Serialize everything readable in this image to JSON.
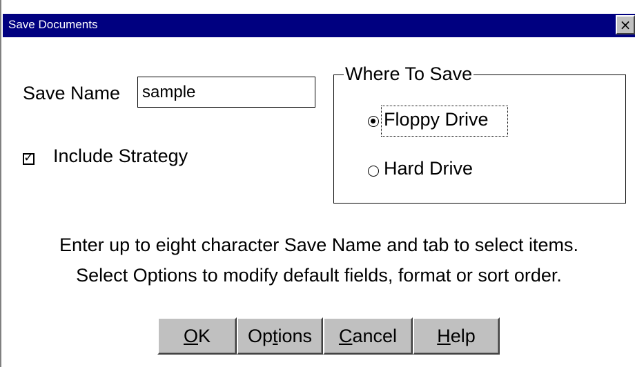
{
  "window": {
    "title": "Save Documents",
    "close_glyph": "×"
  },
  "form": {
    "save_name_label": "Save Name",
    "save_name_value": "sample",
    "include_strategy_label": "Include Strategy",
    "include_strategy_checked": true
  },
  "where_to_save": {
    "legend": "Where To Save",
    "options": [
      {
        "label": "Floppy Drive",
        "selected": true
      },
      {
        "label": "Hard Drive",
        "selected": false
      }
    ]
  },
  "info": {
    "line1": "Enter up to eight character Save Name and tab to select items.",
    "line2": "Select Options to modify default fields, format or sort order."
  },
  "buttons": {
    "ok": {
      "mnemonic": "O",
      "rest": "K"
    },
    "options": {
      "pre": "Op",
      "mnemonic": "t",
      "rest": "ions"
    },
    "cancel": {
      "mnemonic": "C",
      "rest": "ancel"
    },
    "help": {
      "mnemonic": "H",
      "rest": "elp"
    }
  },
  "colors": {
    "titlebar": "#000080",
    "button_face": "#c0c0c0"
  }
}
